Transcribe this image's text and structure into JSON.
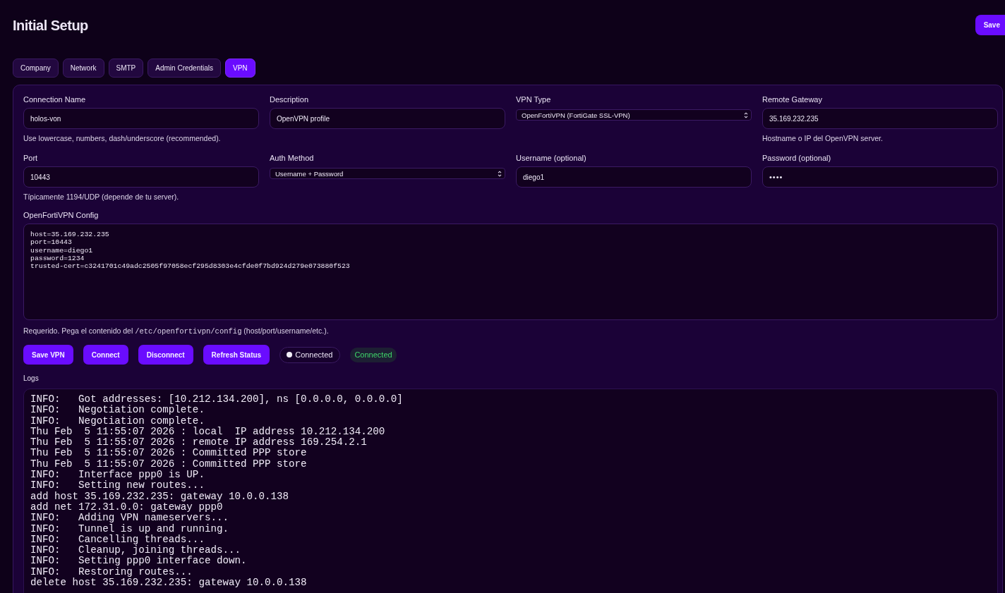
{
  "header": {
    "title": "Initial Setup",
    "save_button": "Save"
  },
  "tabs": [
    {
      "label": "Company",
      "selected": false
    },
    {
      "label": "Network",
      "selected": false
    },
    {
      "label": "SMTP",
      "selected": false
    },
    {
      "label": "Admin Credentials",
      "selected": false
    },
    {
      "label": "VPN",
      "selected": true
    }
  ],
  "form": {
    "fields": [
      {
        "label": "Connection Name",
        "kind": "input",
        "value": "holos-von",
        "hint": "Use lowercase, numbers, dash/underscore (recommended)."
      },
      {
        "label": "Description",
        "kind": "input",
        "value": "OpenVPN profile"
      },
      {
        "label": "VPN Type",
        "kind": "select",
        "value": "OpenFortiVPN (FortiGate SSL-VPN)"
      },
      {
        "label": "Remote Gateway",
        "kind": "input",
        "value": "35.169.232.235",
        "hint": "Hostname o IP del OpenVPN server."
      },
      {
        "label": "Port",
        "kind": "input",
        "value": "10443",
        "hint": "Típicamente 1194/UDP (depende de tu server)."
      },
      {
        "label": "Auth Method",
        "kind": "select",
        "value": "Username + Password"
      },
      {
        "label": "Username (optional)",
        "kind": "input",
        "value": "diego1"
      },
      {
        "label": "Password (optional)",
        "kind": "password",
        "value": "••••"
      }
    ],
    "config": {
      "label": "OpenFortiVPN Config",
      "value": "host=35.169.232.235\nport=10443\nusername=diego1\npassword=1234\ntrusted-cert=c3241701c49adc2505f97058ecf295d8303e4cfde0f7bd924d279e073880f523",
      "hint": "Requerido. Pega el contenido del */etc/openfortivpn/config* (host/port/username/etc.)."
    },
    "actions": [
      "Save VPN",
      "Connect",
      "Disconnect",
      "Refresh Status"
    ],
    "status_pill": {
      "label": "Connected"
    },
    "status_badge": {
      "label": "Connected"
    },
    "logs": {
      "label": "Logs",
      "lines": [
        "INFO:   Got addresses: [10.212.134.200], ns [0.0.0.0, 0.0.0.0]",
        "INFO:   Negotiation complete.",
        "INFO:   Negotiation complete.",
        "Thu Feb  5 11:55:07 2026 : local  IP address 10.212.134.200",
        "Thu Feb  5 11:55:07 2026 : remote IP address 169.254.2.1",
        "Thu Feb  5 11:55:07 2026 : Committed PPP store",
        "Thu Feb  5 11:55:07 2026 : Committed PPP store",
        "INFO:   Interface ppp0 is UP.",
        "INFO:   Setting new routes...",
        "add host 35.169.232.235: gateway 10.0.0.138",
        "add net 172.31.0.0: gateway ppp0",
        "INFO:   Adding VPN nameservers...",
        "INFO:   Tunnel is up and running.",
        "INFO:   Cancelling threads...",
        "INFO:   Cleanup, joining threads...",
        "INFO:   Setting ppp0 interface down.",
        "INFO:   Restoring routes...",
        "delete host 35.169.232.235: gateway 10.0.0.138"
      ]
    }
  }
}
